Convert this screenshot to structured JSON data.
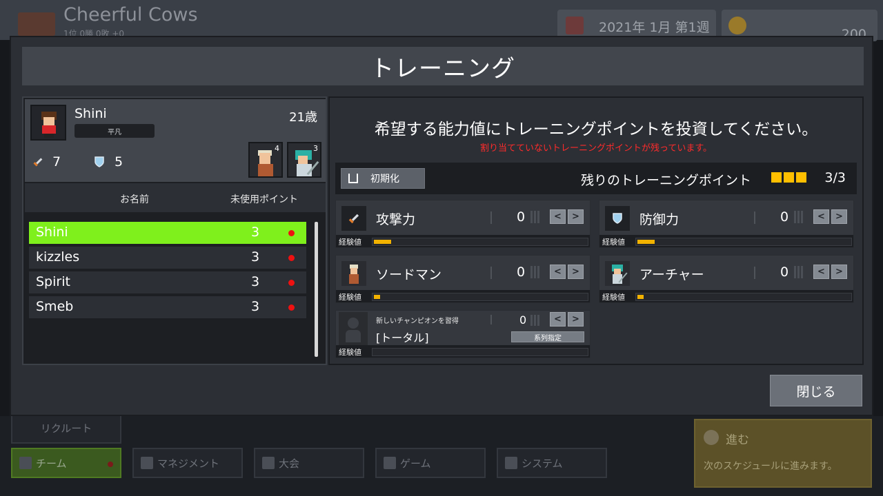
{
  "header": {
    "team_name": "Cheerful Cows",
    "team_record": "1位 0勝 0敗 +0",
    "date": "2021年 1月 第1週",
    "money": "200"
  },
  "modal": {
    "title": "トレーニング",
    "close_label": "閉じる"
  },
  "player": {
    "name": "Shini",
    "age": "21歳",
    "trait": "平凡",
    "attack": "7",
    "defense": "5",
    "champions": [
      {
        "name": "swordsman",
        "level": "4"
      },
      {
        "name": "archer",
        "level": "3"
      }
    ]
  },
  "roster": {
    "col_name": "お名前",
    "col_points": "未使用ポイント",
    "rows": [
      {
        "name": "Shini",
        "points": "3",
        "selected": true
      },
      {
        "name": "kizzles",
        "points": "3",
        "selected": false
      },
      {
        "name": "Spirit",
        "points": "3",
        "selected": false
      },
      {
        "name": "Smeb",
        "points": "3",
        "selected": false
      }
    ]
  },
  "training": {
    "instruction": "希望する能力値にトレーニングポイントを投資してください。",
    "warning": "割り当てていないトレーニングポイントが残っています。",
    "reset_label": "初期化",
    "remaining_label": "残りのトレーニングポイント",
    "remaining_count": "3/3",
    "remaining_value": 3,
    "remaining_max": 3,
    "exp_label": "経験値",
    "stats": [
      {
        "key": "attack",
        "label": "攻撃力",
        "value": "0",
        "exp": 0.08,
        "icon": "sword-icon"
      },
      {
        "key": "defense",
        "label": "防御力",
        "value": "0",
        "exp": 0.08,
        "icon": "shield-icon"
      },
      {
        "key": "swordsman",
        "label": "ソードマン",
        "value": "0",
        "exp": 0.03,
        "icon": "swordsman-portrait-icon"
      },
      {
        "key": "archer",
        "label": "アーチャー",
        "value": "0",
        "exp": 0.03,
        "icon": "archer-portrait-icon"
      }
    ],
    "new_champion": {
      "small_label": "新しいチャンピオンを習得",
      "total_label": "[トータル]",
      "value": "0",
      "series_label": "系列指定",
      "exp": 0
    }
  },
  "bottom_nav": {
    "recruit": "リクルート",
    "team": "チーム",
    "management": "マネジメント",
    "tournament": "大会",
    "game": "ゲーム",
    "system": "システム",
    "advance_title": "進む",
    "advance_desc": "次のスケジュールに進みます。"
  },
  "colors": {
    "selected_row": "#7ff01c",
    "warning": "#ff2b2b",
    "point_square": "#ffbf00",
    "exp_fill": "#f2b200"
  }
}
